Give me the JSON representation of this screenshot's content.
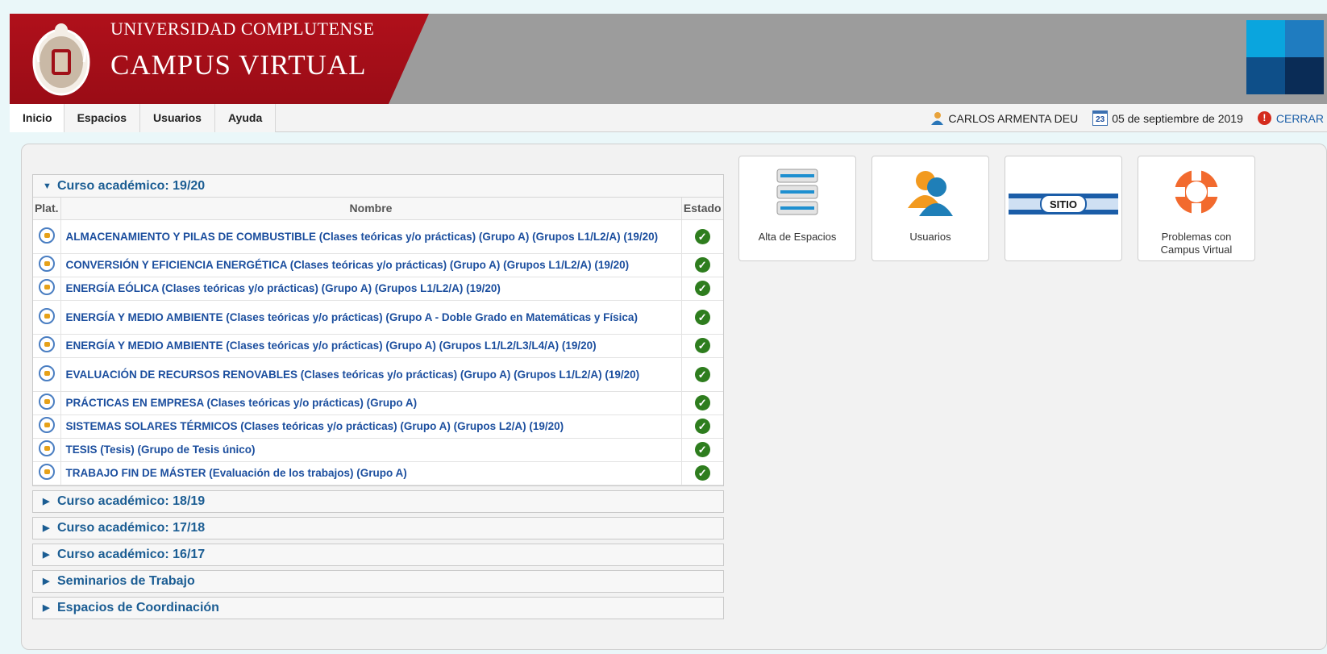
{
  "header": {
    "university": "UNIVERSIDAD COMPLUTENSE",
    "campus": "CAMPUS VIRTUAL",
    "brand_color": "#a80e19",
    "tile_colors": [
      "#0aa5de",
      "#1f7cc0",
      "#0e4f89",
      "#0a2c56"
    ]
  },
  "nav": [
    {
      "label": "Inicio"
    },
    {
      "label": "Espacios"
    },
    {
      "label": "Usuarios"
    },
    {
      "label": "Ayuda"
    }
  ],
  "user": {
    "name": "CARLOS ARMENTA DEU",
    "calendar_day": "23",
    "date": "05 de septiembre de 2019",
    "logout": "CERRAR"
  },
  "tree": {
    "open_section": "Curso académico: 19/20",
    "columns": {
      "plat": "Plat.",
      "nombre": "Nombre",
      "estado": "Estado"
    },
    "courses": [
      {
        "name": "ALMACENAMIENTO Y PILAS DE COMBUSTIBLE (Clases teóricas y/o prácticas) (Grupo A) (Grupos L1/L2/A) (19/20)",
        "estado": "ok"
      },
      {
        "name": "CONVERSIÓN Y EFICIENCIA ENERGÉTICA (Clases teóricas y/o prácticas) (Grupo A) (Grupos L1/L2/A) (19/20)",
        "estado": "ok"
      },
      {
        "name": "ENERGÍA EÓLICA (Clases teóricas y/o prácticas) (Grupo A) (Grupos L1/L2/A) (19/20)",
        "estado": "ok"
      },
      {
        "name": "ENERGÍA Y MEDIO AMBIENTE (Clases teóricas y/o prácticas) (Grupo A - Doble Grado en Matemáticas y Física)",
        "estado": "ok"
      },
      {
        "name": "ENERGÍA Y MEDIO AMBIENTE (Clases teóricas y/o prácticas) (Grupo A) (Grupos L1/L2/L3/L4/A) (19/20)",
        "estado": "ok"
      },
      {
        "name": "EVALUACIÓN DE RECURSOS RENOVABLES (Clases teóricas y/o prácticas) (Grupo A) (Grupos L1/L2/A) (19/20)",
        "estado": "ok"
      },
      {
        "name": "PRÁCTICAS EN EMPRESA (Clases teóricas y/o prácticas) (Grupo A)",
        "estado": "ok"
      },
      {
        "name": "SISTEMAS SOLARES TÉRMICOS (Clases teóricas y/o prácticas) (Grupo A) (Grupos L2/A) (19/20)",
        "estado": "ok"
      },
      {
        "name": "TESIS (Tesis) (Grupo de Tesis único)",
        "estado": "ok"
      },
      {
        "name": "TRABAJO FIN DE MÁSTER (Evaluación de los trabajos) (Grupo A)",
        "estado": "ok"
      }
    ],
    "collapsed_sections": [
      "Curso académico: 18/19",
      "Curso académico: 17/18",
      "Curso académico: 16/17",
      "Seminarios de Trabajo",
      "Espacios de Coordinación"
    ]
  },
  "shortcuts": [
    {
      "label": "Alta de Espacios",
      "icon": "servers-icon"
    },
    {
      "label": "Usuarios",
      "icon": "users-icon"
    },
    {
      "label": "SITIO",
      "icon": "sitio-banner-icon"
    },
    {
      "label": "Problemas con Campus Virtual",
      "icon": "lifebuoy-icon"
    }
  ]
}
